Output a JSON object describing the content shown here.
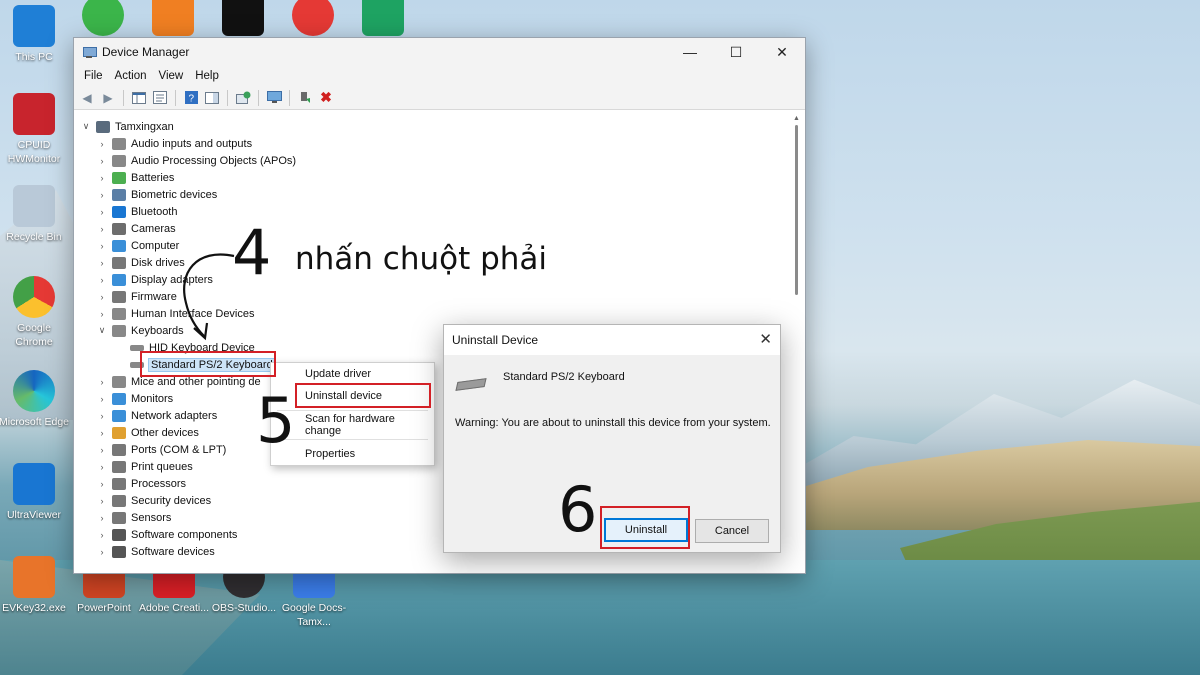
{
  "desktop": {
    "icons": [
      {
        "label": "This PC",
        "icon": "monitor-icon",
        "color": "#1f7fd6"
      },
      {
        "label": "CPUID HWMonitor",
        "icon": "cpuid-icon",
        "color": "#c8242d"
      },
      {
        "label": "Recycle Bin",
        "icon": "recycle-bin-icon",
        "color": "#b9c9d8"
      },
      {
        "label": "Google Chrome",
        "icon": "chrome-icon",
        "color": "#e53935"
      },
      {
        "label": "Microsoft Edge",
        "icon": "edge-icon",
        "color": "#1e8fd9"
      },
      {
        "label": "UltraViewer",
        "icon": "ultraviewer-icon",
        "color": "#1976d2"
      },
      {
        "label": "EVKey32.exe",
        "icon": "evkey-icon",
        "color": "#e8742a"
      },
      {
        "label": "PowerPoint",
        "icon": "powerpoint-icon",
        "color": "#d04423"
      },
      {
        "label": "Adobe Creati...",
        "icon": "adobe-cc-icon",
        "color": "#da1f26"
      },
      {
        "label": "OBS-Studio...",
        "icon": "obs-icon",
        "color": "#302e31"
      },
      {
        "label": "Google Docs-Tamx...",
        "icon": "google-docs-icon",
        "color": "#3b7de9"
      }
    ],
    "top_icons": [
      {
        "icon": "coccoc-icon",
        "color": "#3bb54a"
      },
      {
        "icon": "foxit-icon",
        "color": "#f07f22"
      },
      {
        "icon": "capcut-icon",
        "color": "#111111"
      },
      {
        "icon": "chrome-canary-icon",
        "color": "#e53935"
      },
      {
        "icon": "google-sheets-icon",
        "color": "#1ea362"
      }
    ]
  },
  "device_manager": {
    "title": "Device Manager",
    "menu": [
      "File",
      "Action",
      "View",
      "Help"
    ],
    "window_controls": {
      "minimize": "—",
      "maximize": "☐",
      "close": "✕"
    },
    "root": "Tamxingxan",
    "tree": [
      {
        "label": "Audio inputs and outputs",
        "icon": "speaker-icon",
        "color": "#888888",
        "expanded": false
      },
      {
        "label": "Audio Processing Objects (APOs)",
        "icon": "speaker-icon",
        "color": "#888888",
        "expanded": false
      },
      {
        "label": "Batteries",
        "icon": "battery-icon",
        "color": "#4caf50",
        "expanded": false
      },
      {
        "label": "Biometric devices",
        "icon": "fingerprint-icon",
        "color": "#5b7fa6",
        "expanded": false
      },
      {
        "label": "Bluetooth",
        "icon": "bluetooth-icon",
        "color": "#1976d2",
        "expanded": false
      },
      {
        "label": "Cameras",
        "icon": "camera-icon",
        "color": "#6d6d6d",
        "expanded": false
      },
      {
        "label": "Computer",
        "icon": "computer-icon",
        "color": "#3a8fd8",
        "expanded": false
      },
      {
        "label": "Disk drives",
        "icon": "disk-icon",
        "color": "#777777",
        "expanded": false
      },
      {
        "label": "Display adapters",
        "icon": "display-icon",
        "color": "#3a8fd8",
        "expanded": false
      },
      {
        "label": "Firmware",
        "icon": "firmware-icon",
        "color": "#777777",
        "expanded": false
      },
      {
        "label": "Human Interface Devices",
        "icon": "hid-icon",
        "color": "#888888",
        "expanded": false
      },
      {
        "label": "Keyboards",
        "icon": "keyboard-icon",
        "color": "#888888",
        "expanded": true,
        "children": [
          {
            "label": "HID Keyboard Device",
            "icon": "keyboard-icon",
            "color": "#888888"
          },
          {
            "label": "Standard PS/2 Keyboard",
            "icon": "keyboard-icon",
            "color": "#888888",
            "selected": true
          }
        ]
      },
      {
        "label": "Mice and other pointing de",
        "icon": "mouse-icon",
        "color": "#888888",
        "expanded": false
      },
      {
        "label": "Monitors",
        "icon": "monitor-icon",
        "color": "#3a8fd8",
        "expanded": false
      },
      {
        "label": "Network adapters",
        "icon": "network-icon",
        "color": "#3a8fd8",
        "expanded": false
      },
      {
        "label": "Other devices",
        "icon": "other-devices-icon",
        "color": "#e0a030",
        "expanded": false
      },
      {
        "label": "Ports (COM & LPT)",
        "icon": "port-icon",
        "color": "#777777",
        "expanded": false
      },
      {
        "label": "Print queues",
        "icon": "printer-icon",
        "color": "#777777",
        "expanded": false
      },
      {
        "label": "Processors",
        "icon": "processor-icon",
        "color": "#777777",
        "expanded": false
      },
      {
        "label": "Security devices",
        "icon": "security-icon",
        "color": "#777777",
        "expanded": false
      },
      {
        "label": "Sensors",
        "icon": "sensor-icon",
        "color": "#777777",
        "expanded": false
      },
      {
        "label": "Software components",
        "icon": "software-icon",
        "color": "#555555",
        "expanded": false
      },
      {
        "label": "Software devices",
        "icon": "software-icon",
        "color": "#555555",
        "expanded": false
      }
    ]
  },
  "context_menu": {
    "items": [
      "Update driver",
      "Uninstall device",
      "Scan for hardware change",
      "Properties"
    ]
  },
  "dialog": {
    "title": "Uninstall Device",
    "close": "✕",
    "device": "Standard PS/2 Keyboard",
    "warning": "Warning: You are about to uninstall this device from your system.",
    "uninstall": "Uninstall",
    "cancel": "Cancel"
  },
  "annotations": {
    "step4": "4",
    "step4_text": "nhấn chuột phải",
    "step5": "5",
    "step6": "6",
    "highlight_color": "#d32026"
  }
}
